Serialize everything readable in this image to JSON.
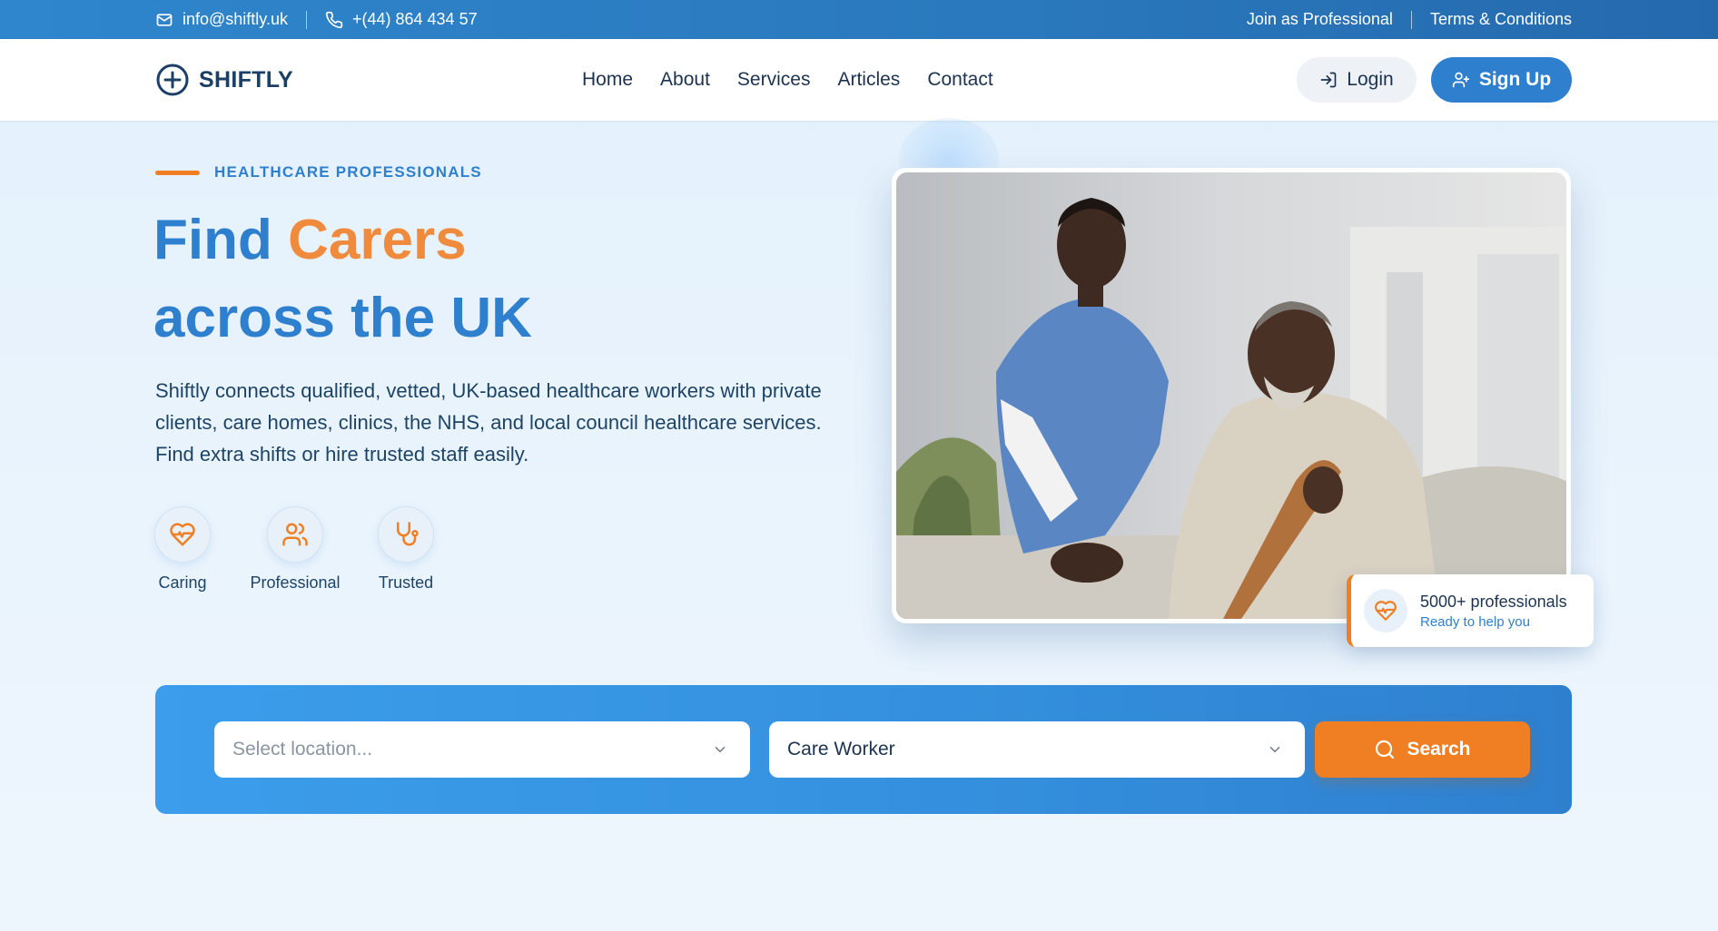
{
  "topbar": {
    "email": "info@shiftly.uk",
    "phone": "+(44) 864 434 57",
    "join": "Join as Professional",
    "terms": "Terms & Conditions"
  },
  "nav": {
    "brand": "SHIFTLY",
    "items": [
      "Home",
      "About",
      "Services",
      "Articles",
      "Contact"
    ],
    "login": "Login",
    "signup": "Sign Up"
  },
  "hero": {
    "eyebrow": "HEALTHCARE PROFESSIONALS",
    "title_part1": "Find",
    "title_accent": "Carers",
    "title_line2": "across the UK",
    "description": "Shiftly connects qualified, vetted, UK-based healthcare workers with private clients, care homes, clinics, the NHS, and local council healthcare services. Find extra shifts or hire trusted staff easily.",
    "features": [
      {
        "label": "Caring",
        "icon": "heart-pulse-icon"
      },
      {
        "label": "Professional",
        "icon": "users-icon"
      },
      {
        "label": "Trusted",
        "icon": "stethoscope-icon"
      }
    ]
  },
  "badge": {
    "title": "5000+ professionals",
    "subtitle": "Ready to help you"
  },
  "search": {
    "location_placeholder": "Select location...",
    "role_value": "Care Worker",
    "button": "Search"
  },
  "colors": {
    "primary": "#2e7fcd",
    "accent": "#f07e22",
    "dark": "#1b3350"
  }
}
